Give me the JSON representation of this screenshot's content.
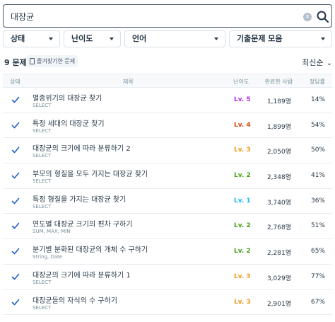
{
  "search": {
    "value": "대장균",
    "clear_icon": "clear-circle-icon",
    "button_icon": "search-icon"
  },
  "filters": [
    {
      "label": "상태"
    },
    {
      "label": "난이도"
    },
    {
      "label": "언어"
    },
    {
      "label": "기출문제 모음"
    }
  ],
  "results": {
    "count_label": "9 문제",
    "bookmark_label": "즐겨찾기한 문제",
    "sort_label": "최신순"
  },
  "table": {
    "headers": {
      "status": "상태",
      "title": "제목",
      "level": "난이도",
      "done": "완료한 사람",
      "rate": "정답률"
    },
    "rows": [
      {
        "title": "멸종위기의 대장균 찾기",
        "sub": "SELECT",
        "level": "Lv. 5",
        "done": "1,189명",
        "rate": "14%"
      },
      {
        "title": "특정 세대의 대장균 찾기",
        "sub": "SELECT",
        "level": "Lv. 4",
        "done": "1,899명",
        "rate": "54%"
      },
      {
        "title": "대장균의 크기에 따라 분류하기 2",
        "sub": "SELECT",
        "level": "Lv. 3",
        "done": "2,050명",
        "rate": "50%"
      },
      {
        "title": "부모의 형질을 모두 가지는 대장균 찾기",
        "sub": "SELECT",
        "level": "Lv. 2",
        "done": "2,348명",
        "rate": "41%"
      },
      {
        "title": "특정 형질을 가지는 대장균 찾기",
        "sub": "SELECT",
        "level": "Lv. 1",
        "done": "3,740명",
        "rate": "36%"
      },
      {
        "title": "연도별 대장균 크기의 편차 구하기",
        "sub": "SUM, MAX, MIN",
        "level": "Lv. 2",
        "done": "2,768명",
        "rate": "51%"
      },
      {
        "title": "분기별 분화된 대장균의 개체 수 구하기",
        "sub": "String, Date",
        "level": "Lv. 2",
        "done": "2,281명",
        "rate": "65%"
      },
      {
        "title": "대장균의 크기에 따라 분류하기 1",
        "sub": "SELECT",
        "level": "Lv. 3",
        "done": "3,029명",
        "rate": "77%"
      },
      {
        "title": "대장균들의 자식의 수 구하기",
        "sub": "SELECT",
        "level": "Lv. 3",
        "done": "2,901명",
        "rate": "67%"
      }
    ]
  },
  "colors": {
    "level_5": "#b02cf0",
    "level_4": "#d9480f",
    "level_3": "#ed9c1a",
    "level_2": "#44a016",
    "level_1": "#1bbaff",
    "check": "#1e61c4"
  }
}
